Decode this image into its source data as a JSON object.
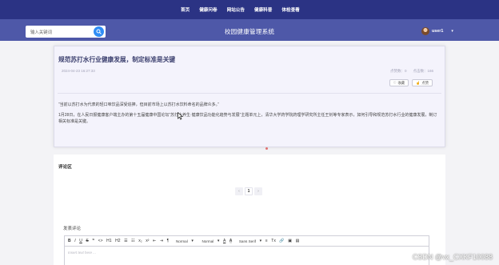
{
  "top_nav": [
    "首页",
    "健康问卷",
    "网站公告",
    "健康科普",
    "体检查看"
  ],
  "search": {
    "placeholder": "输入关键词"
  },
  "site_title": "校园健康管理系统",
  "user": {
    "name": "user1"
  },
  "article": {
    "title": "规范苏打水行业健康发展，制定标准是关键",
    "date": "2024-04-23 16:27:33",
    "stats": [
      "点赞数：0",
      "点击数：166"
    ],
    "collect_label": "收藏",
    "like_label": "点赞",
    "quote": "“当前以苏打水为代表的轻口味饮品深受追捧，但目前市场上以苏打水饮料命名的品牌众多。”",
    "body": "1月28日，在人民日报健康客户端主办的第十五届健康中国论坛“苏打水养生·健康饮品功能化趋势与发展”主题单元上，清华大学药学院药理学研究所主任王钊等专家表示，如何引导和规范苏打水行业的健康发展，制订相关标准是关键。"
  },
  "comments": {
    "title": "评论区",
    "pager": {
      "prev": "‹",
      "current": "1",
      "next": "›"
    },
    "post_label": "发表评论",
    "toolbar": {
      "bold": "B",
      "italic": "I",
      "underline": "U",
      "strike": "S",
      "blockquote": "❞",
      "code": "<>",
      "h1": "H1",
      "h2": "H2",
      "ol": "☰",
      "ul": "☷",
      "sub": "x₂",
      "sup": "x²",
      "outdent": "⇤",
      "indent": "⇥",
      "direction": "¶",
      "size_select": "Normal",
      "header_select": "Normal",
      "color": "A",
      "background": "A",
      "font_select": "Sans Serif",
      "align": "≡",
      "clean": "Tx",
      "link": "🔗",
      "image": "▣",
      "video": "▤"
    },
    "editor_placeholder": "Insert text here ..."
  },
  "watermark": "CSDN @vx_CXKF10088",
  "colors": {
    "nav": "#2b3384",
    "header": "#4e58a8",
    "search_button": "#2f8df5",
    "title": "#3b3f6e"
  }
}
